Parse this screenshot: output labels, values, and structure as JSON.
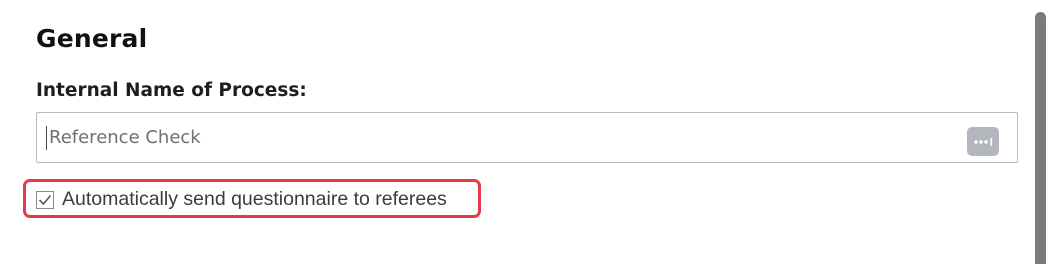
{
  "section": {
    "title": "General"
  },
  "process_name": {
    "label": "Internal Name of Process:",
    "value": "Reference Check",
    "more_icon": "ellipsis-icon"
  },
  "auto_send": {
    "label": "Automatically send questionnaire to referees",
    "checked": true,
    "highlight_color": "#e53a48"
  }
}
